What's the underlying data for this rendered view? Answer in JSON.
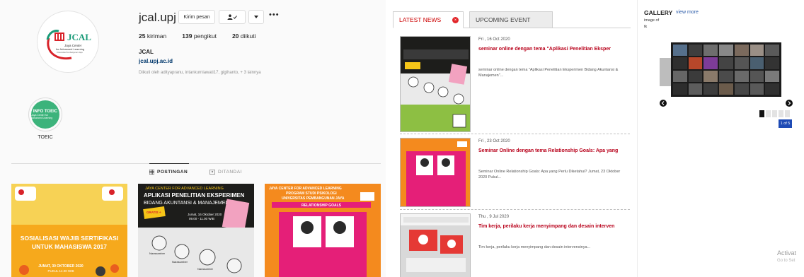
{
  "instagram": {
    "username": "jcal.upj",
    "buttons": {
      "message": "Kirim pesan",
      "more": "•••"
    },
    "stats": [
      {
        "count": "25",
        "label": "kiriman"
      },
      {
        "count": "139",
        "label": "pengikut"
      },
      {
        "count": "20",
        "label": "diikuti"
      }
    ],
    "name": "JCAL",
    "link": "jcal.upj.ac.id",
    "followed_by": "Diikuti oleh adityapranu, intankurniawati17, gigihanto, + 3 lainnya",
    "logo_text": {
      "mark": "JCAL",
      "line1": "Jaya Center",
      "line2": "for Advanced Learning",
      "line3": "Universitas Pembangunan Jaya"
    },
    "highlight": {
      "badge_line1": "INFO TOEIC",
      "badge_line2": "Jaya Center for Advanced Learning",
      "label": "TOEIC"
    },
    "tabs": {
      "posts": "POSTINGAN",
      "tagged": "DITANDAI"
    },
    "posts": [
      {
        "headline": "SOSIALISASI WAJIB SERTIFIKASI UNTUK MAHASISWA 2017",
        "date": "JUMAT, 30 OKTOBER 2020",
        "time": "PUKUL 14.00 WIB"
      },
      {
        "header": "JAYA CENTER FOR ADVANCED LEARNING",
        "headline": "APLIKASI PENELITIAN EKSPERIMEN BIDANG AKUNTANSI & MANAJEMEN",
        "badge": "GRATIS + E-SERTIFIKAT",
        "date": "Jumat, 16 Oktober 2020",
        "time": "09.00 - 11.00 WIB",
        "roles": [
          "Narasumber",
          "Narasumber",
          "Narasumber"
        ]
      },
      {
        "header": "JAYA CENTER FOR ADVANCED LEARNING",
        "subheader": "PROGRAM STUDI PSIKOLOGI",
        "org": "UNIVERSITAS PEMBANGUNAN JAYA",
        "headline": "RELATIONSHIP GOALS"
      }
    ]
  },
  "news": {
    "tabs": {
      "latest": "LATEST NEWS",
      "upcoming": "UPCOMING EVENT",
      "close": "×"
    },
    "items": [
      {
        "date": "Fri , 16 Oct 2020",
        "title": "seminar online dengan tema \"Aplikasi Penelitian Eksper",
        "desc": "seminar online dengan tema \"Aplikasi Penelitian Eksperimen Bidang Akuntansi & Manajemen\"..."
      },
      {
        "date": "Fri , 23 Oct 2020",
        "title": "Seminar Online dengan tema Relationship Goals: Apa yang",
        "desc": "Seminar Online Relationship Goals: Apa yang Perlu Diketahui? Jumat, 23 Oktober 2020 Pukul..."
      },
      {
        "date": "Thu , 9 Jul 2020",
        "title": "Tim kerja, perilaku kerja menyimpang dan desain interven",
        "desc": "Tim kerja, perilaku kerja menyimpang dan desain intervensinya..."
      }
    ]
  },
  "gallery": {
    "title": "GALLERY",
    "view_more": "view more",
    "caption1": "image of",
    "caption2": "tk",
    "count": "1 of 5",
    "active_page": 1,
    "total_pages": 5,
    "watermark_line1": "Activat",
    "watermark_line2": "Go to Set"
  },
  "colors": {
    "ig_bg": "#fafafa",
    "news_title": "#b8001a",
    "news_tab_active": "#cc0000",
    "gallery_link": "#2b5ba8",
    "gallery_badge": "#1e4bb5"
  }
}
